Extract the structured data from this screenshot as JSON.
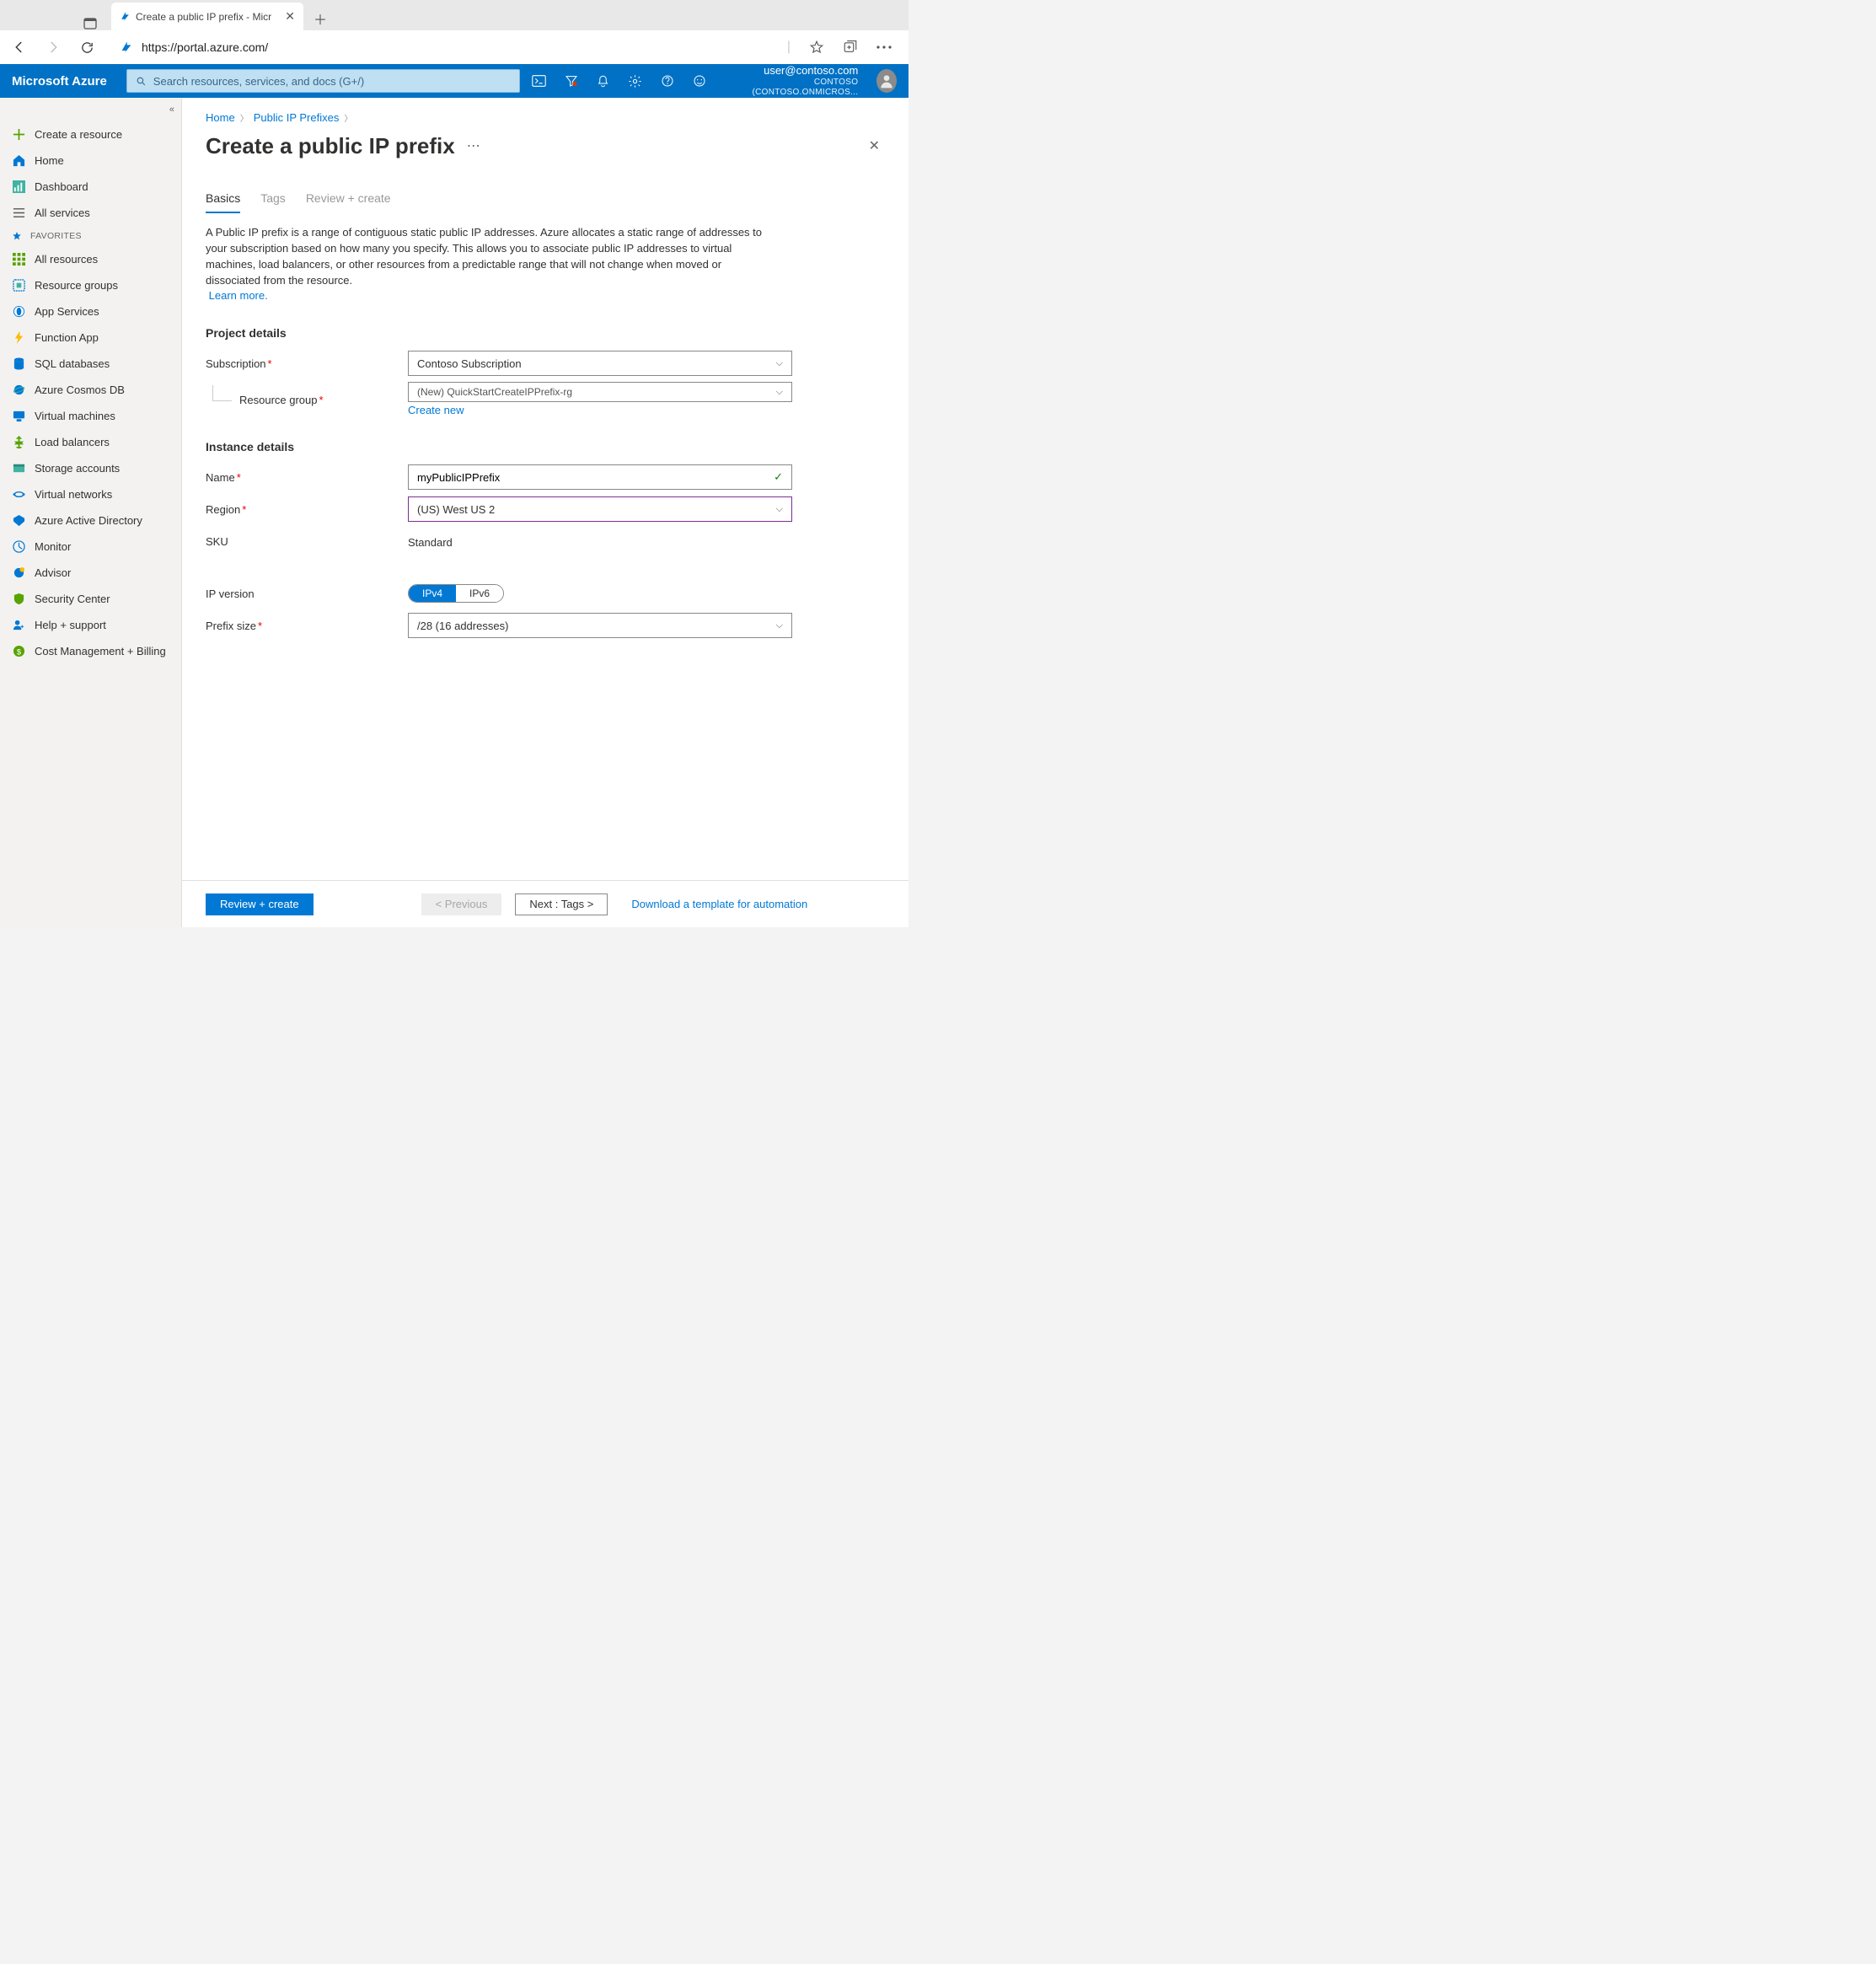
{
  "browser": {
    "tab_title": "Create a public IP prefix - Micr",
    "url": "https://portal.azure.com/"
  },
  "azure_header": {
    "brand": "Microsoft Azure",
    "search_placeholder": "Search resources, services, and docs (G+/)",
    "user_email": "user@contoso.com",
    "tenant": "CONTOSO (CONTOSO.ONMICROS..."
  },
  "sidebar": {
    "create": "Create a resource",
    "home": "Home",
    "dashboard": "Dashboard",
    "all_services": "All services",
    "favorites_label": "FAVORITES",
    "items": [
      "All resources",
      "Resource groups",
      "App Services",
      "Function App",
      "SQL databases",
      "Azure Cosmos DB",
      "Virtual machines",
      "Load balancers",
      "Storage accounts",
      "Virtual networks",
      "Azure Active Directory",
      "Monitor",
      "Advisor",
      "Security Center",
      "Help + support",
      "Cost Management + Billing"
    ]
  },
  "breadcrumb": {
    "home": "Home",
    "parent": "Public IP Prefixes"
  },
  "page": {
    "title": "Create a public IP prefix",
    "tabs": {
      "basics": "Basics",
      "tags": "Tags",
      "review": "Review + create"
    },
    "description": "A Public IP prefix is a range of contiguous static public IP addresses. Azure allocates a static range of addresses to your subscription based on how many you specify. This allows you to associate public IP addresses to virtual machines, load balancers, or other resources from a predictable range that will not change when moved or dissociated from the resource.",
    "learn_more": "Learn more."
  },
  "sections": {
    "project": "Project details",
    "instance": "Instance details"
  },
  "labels": {
    "subscription": "Subscription",
    "resource_group": "Resource group",
    "create_new": "Create new",
    "name": "Name",
    "region": "Region",
    "sku": "SKU",
    "ip_version": "IP version",
    "prefix_size": "Prefix size"
  },
  "values": {
    "subscription": "Contoso Subscription",
    "resource_group": "(New) QuickStartCreateIPPrefix-rg",
    "name": "myPublicIPPrefix",
    "region": "(US) West US 2",
    "sku": "Standard",
    "ipv4": "IPv4",
    "ipv6": "IPv6",
    "prefix_size": "/28 (16 addresses)"
  },
  "footer": {
    "review": "Review + create",
    "previous": "< Previous",
    "next": "Next : Tags >",
    "download": "Download a template for automation"
  }
}
